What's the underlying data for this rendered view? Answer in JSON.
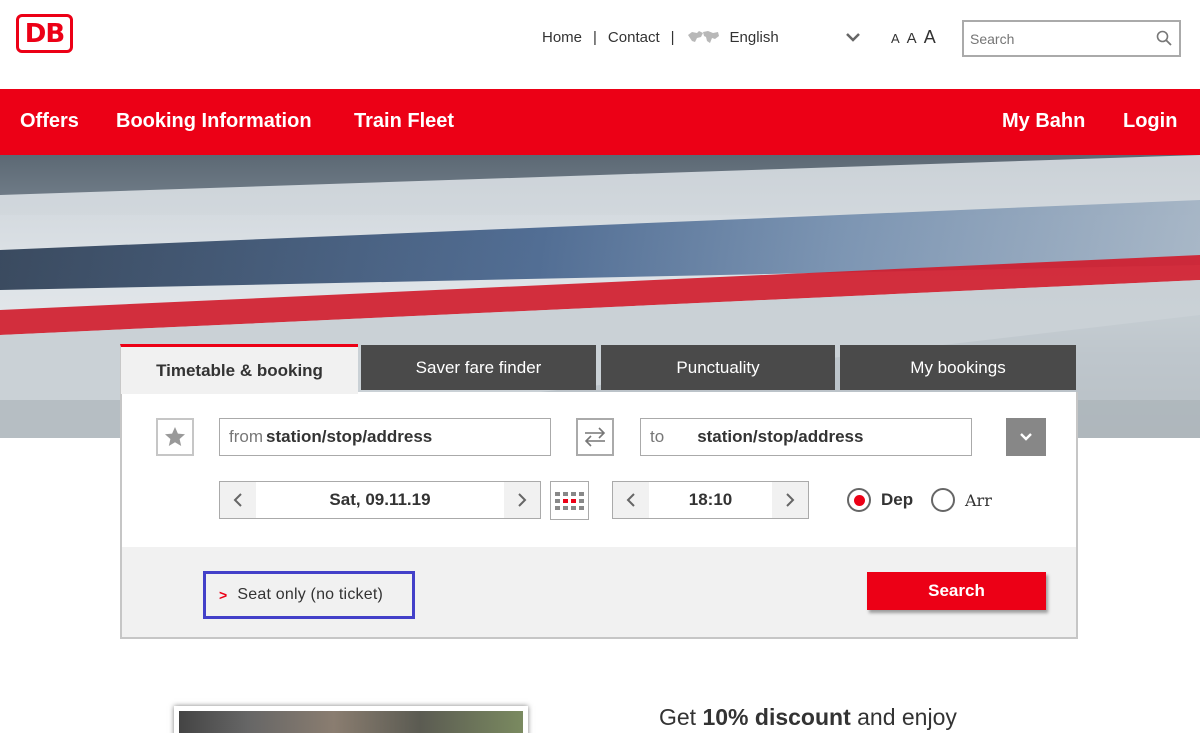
{
  "header": {
    "logo_text": "DB",
    "links": {
      "home": "Home",
      "contact": "Contact",
      "language": "English"
    },
    "separators": [
      "|",
      "|"
    ],
    "font_sizes": [
      "A",
      "A",
      "A"
    ],
    "search_placeholder": "Search"
  },
  "mainnav": {
    "offers": "Offers",
    "booking_information": "Booking Information",
    "train_fleet": "Train Fleet",
    "my_bahn": "My Bahn",
    "login": "Login"
  },
  "booking": {
    "tabs": [
      "Timetable & booking",
      "Saver fare finder",
      "Punctuality",
      "My bookings"
    ],
    "from_prefix": "from",
    "from_placeholder": "station/stop/address",
    "to_prefix": "to",
    "to_placeholder": "station/stop/address",
    "date": "Sat, 09.11.19",
    "time": "18:10",
    "dep_label": "Dep",
    "arr_label": "Arr",
    "departure_selected": true,
    "seat_only_label": "Seat only (no ticket)",
    "search_label": "Search"
  },
  "promo": {
    "prefix": "Get ",
    "highlight": "10% discount",
    "suffix": " and enjoy"
  },
  "colors": {
    "brand_red": "#ec0016",
    "tab_dark": "#4a4a4a",
    "highlight_border": "#4340c9"
  }
}
